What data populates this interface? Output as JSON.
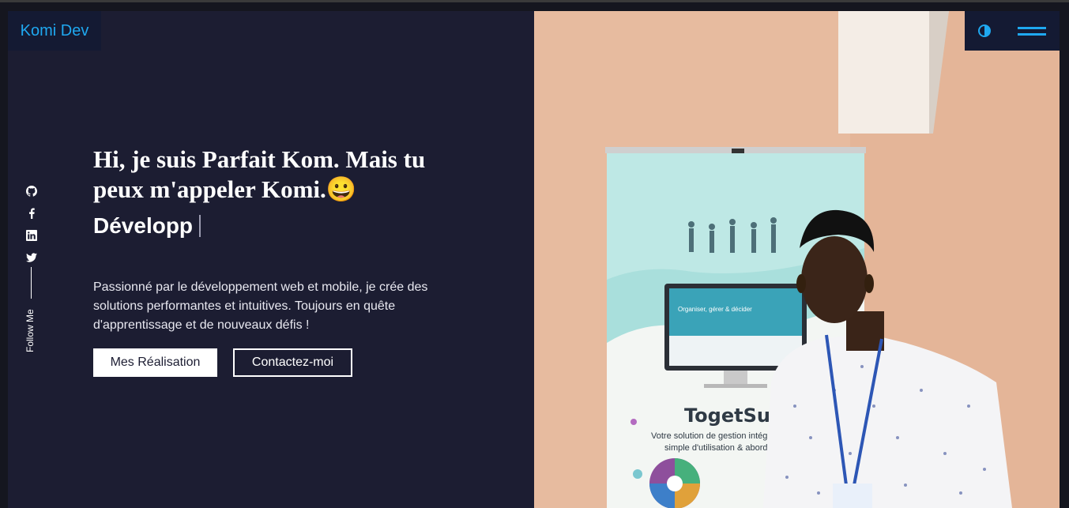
{
  "header": {
    "logo": "Komi Dev"
  },
  "controls": {
    "theme_icon": "half-circle-icon",
    "menu_icon": "hamburger-icon"
  },
  "social": {
    "icons": [
      "github-icon",
      "facebook-icon",
      "linkedin-icon",
      "twitter-icon"
    ],
    "label": "Follow Me"
  },
  "hero": {
    "title": "Hi, je suis Parfait Kom. Mais tu peux m'appeler Komi.😀",
    "typed": "Développ",
    "description": "Passionné par le développement web et mobile, je crée des solutions performantes et intuitives. Toujours en quête d'apprentissage et de nouveaux défis !",
    "primary_button": "Mes Réalisation",
    "secondary_button": "Contactez-moi"
  },
  "photo": {
    "banner_brand": "TogetSu",
    "banner_tagline_1": "Votre solution de gestion intégré",
    "banner_tagline_2": "simple d'utilisation & abordable",
    "banner_screen_title": "Organiser, gérer & décider"
  },
  "colors": {
    "accent": "#1fa8f0",
    "background": "#1c1d32",
    "panel": "#141a33"
  }
}
